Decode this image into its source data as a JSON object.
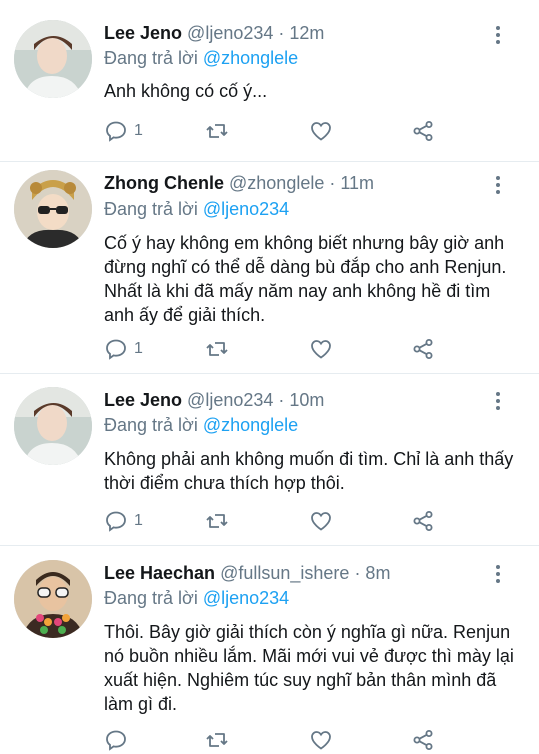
{
  "colors": {
    "text": "#14171a",
    "muted": "#657786",
    "mention": "#1da1f2",
    "divider": "#e6ecf0"
  },
  "icons": {
    "reply": "reply-icon",
    "retweet": "retweet-icon",
    "like": "heart-icon",
    "share": "share-icon",
    "more": "more-vertical-icon"
  },
  "tweets": [
    {
      "name": "Lee Jeno",
      "handle": "@ljeno234",
      "time": "· 12m",
      "reply_prefix": "Đang trả lời",
      "reply_to": "@zhonglele",
      "text": "Anh không có cố ý...",
      "reply_count": "1"
    },
    {
      "name": "Zhong Chenle",
      "handle": "@zhonglele",
      "time": "· 11m",
      "reply_prefix": "Đang trả lời",
      "reply_to": "@ljeno234",
      "text": "Cố ý hay không em không biết nhưng  bây giờ anh đừng nghĩ có thể dễ dàng bù đắp cho anh Renjun. Nhất là khi đã mấy năm nay anh không hề đi tìm anh ấy để giải thích.",
      "reply_count": "1"
    },
    {
      "name": "Lee Jeno",
      "handle": "@ljeno234",
      "time": "· 10m",
      "reply_prefix": "Đang trả lời",
      "reply_to": "@zhonglele",
      "text": "Không phải anh không muốn đi tìm. Chỉ là anh thấy thời điểm chưa thích hợp thôi.",
      "reply_count": "1"
    },
    {
      "name": "Lee Haechan",
      "handle": "@fullsun_ishere",
      "time": "· 8m",
      "reply_prefix": "Đang trả lời",
      "reply_to": "@ljeno234",
      "text": "Thôi. Bây giờ giải thích còn ý nghĩa gì nữa. Renjun nó buồn nhiều lắm. Mãi mới vui vẻ được thì mày lại xuất hiện. Nghiêm túc suy nghĩ bản thân mình đã làm gì đi.",
      "reply_count": ""
    }
  ]
}
